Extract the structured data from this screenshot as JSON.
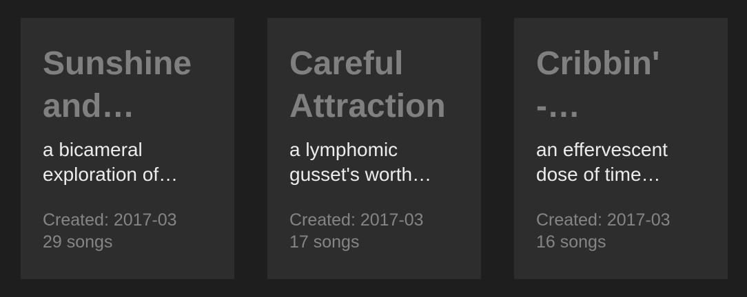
{
  "playlists": [
    {
      "title_line1": "Sunshine",
      "title_line2": "and",
      "desc_line1": "a bicameral",
      "desc_line2": "exploration of",
      "created": "Created: 2017-03",
      "songs": "29 songs"
    },
    {
      "title_line1": "Careful",
      "title_line2": "Attraction",
      "desc_line1": "a lymphomic",
      "desc_line2": "gusset's worth",
      "created": "Created: 2017-03",
      "songs": "17 songs"
    },
    {
      "title_line1": "Cribbin'",
      "title_line2": "-",
      "desc_line1": "an effervescent",
      "desc_line2": "dose of time",
      "created": "Created: 2017-03",
      "songs": "16 songs"
    }
  ],
  "colors": {
    "background": "#1e1e1e",
    "card": "#2d2d2d",
    "title": "#808080",
    "description": "#ececec",
    "meta": "#858585"
  }
}
